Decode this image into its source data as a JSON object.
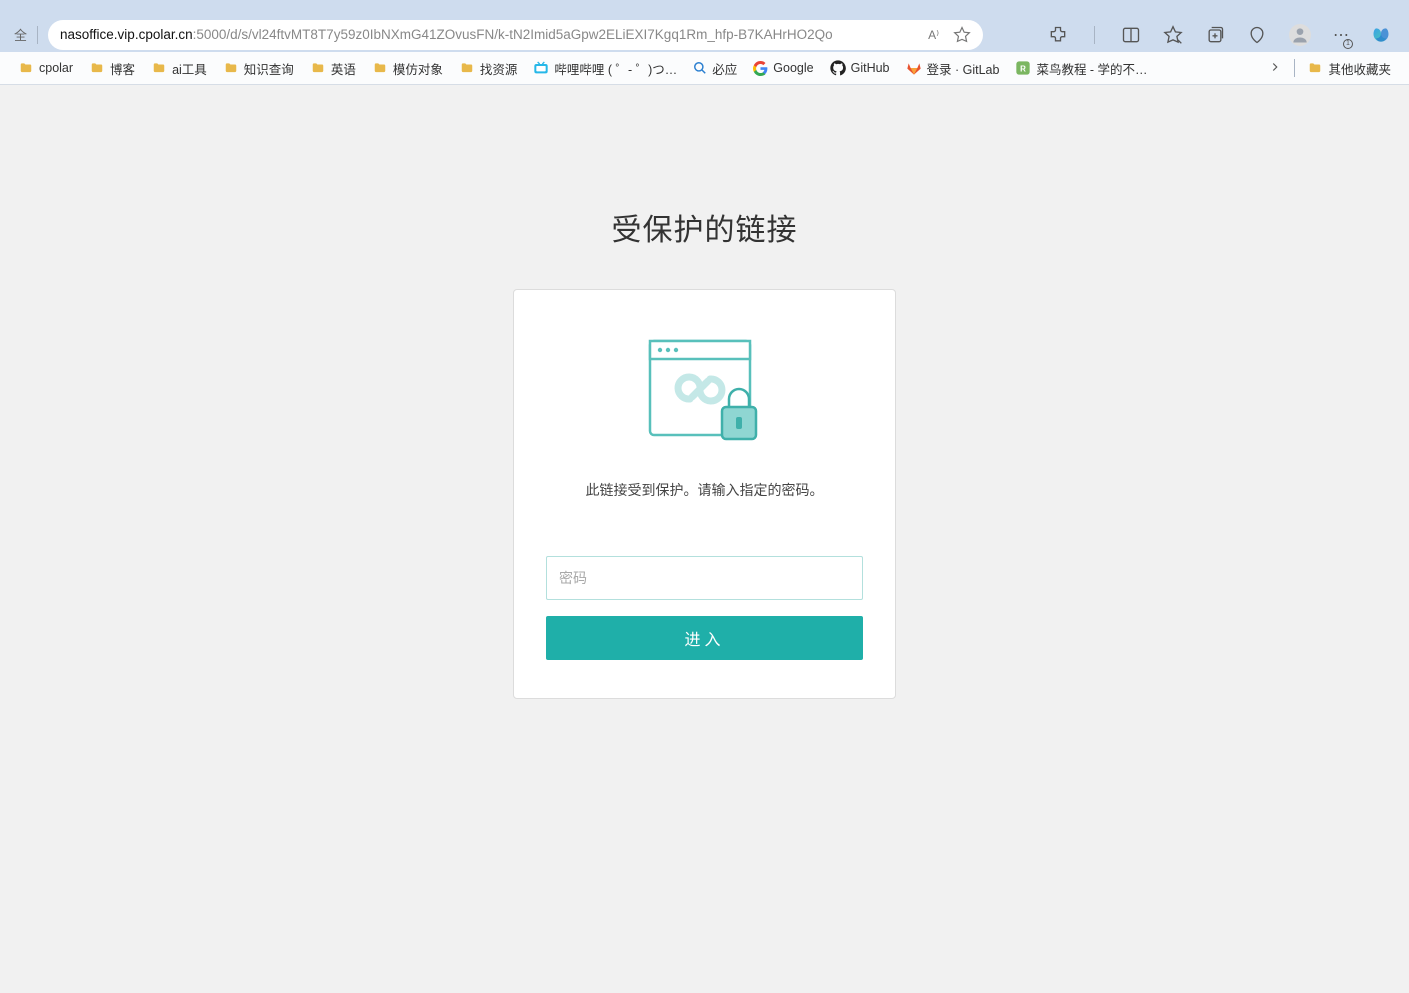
{
  "address_bar": {
    "security_label": "全",
    "url_host": "nasoffice.vip.cpolar.cn",
    "url_port": ":5000",
    "url_path": "/d/s/vl24ftvMT8T7y59z0IbNXmG41ZOvusFN/k-tN2Imid5aGpw2ELiEXI7Kgq1Rm_hfp-B7KAHrHO2Qo",
    "read_aloud_label": "A⁾"
  },
  "bookmarks": [
    {
      "label": "cpolar",
      "type": "folder"
    },
    {
      "label": "博客",
      "type": "folder"
    },
    {
      "label": "ai工具",
      "type": "folder"
    },
    {
      "label": "知识查询",
      "type": "folder"
    },
    {
      "label": "英语",
      "type": "folder"
    },
    {
      "label": "模仿对象",
      "type": "folder"
    },
    {
      "label": "找资源",
      "type": "folder"
    },
    {
      "label": "哔哩哔哩 ( ゜- ゜)つ…",
      "type": "bilibili"
    },
    {
      "label": "必应",
      "type": "bing"
    },
    {
      "label": "Google",
      "type": "google"
    },
    {
      "label": "GitHub",
      "type": "github"
    },
    {
      "label": "登录 · GitLab",
      "type": "gitlab"
    },
    {
      "label": "菜鸟教程 - 学的不…",
      "type": "runoob"
    }
  ],
  "other_bookmarks_label": "其他收藏夹",
  "page": {
    "title": "受保护的链接",
    "message": "此链接受到保护。请输入指定的密码。",
    "password_placeholder": "密码",
    "enter_button": "进入"
  }
}
